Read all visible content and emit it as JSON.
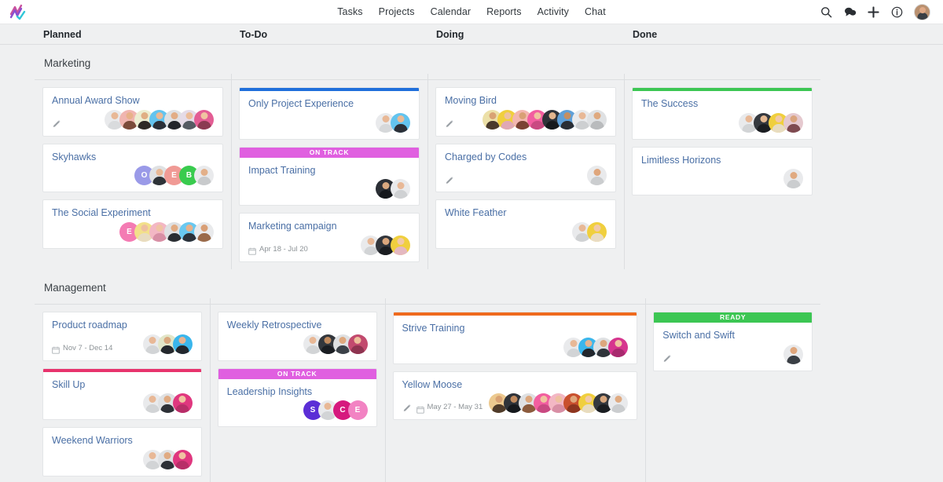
{
  "nav": {
    "logo_name": "zigzag-check-logo",
    "links": [
      {
        "label": "Tasks"
      },
      {
        "label": "Projects"
      },
      {
        "label": "Calendar"
      },
      {
        "label": "Reports"
      },
      {
        "label": "Activity"
      },
      {
        "label": "Chat"
      }
    ],
    "icons": [
      {
        "name": "search-icon"
      },
      {
        "name": "chat-bubble-icon"
      },
      {
        "name": "plus-icon"
      },
      {
        "name": "info-icon"
      }
    ]
  },
  "columns": [
    {
      "label": "Planned"
    },
    {
      "label": "To-Do"
    },
    {
      "label": "Doing"
    },
    {
      "label": "Done"
    }
  ],
  "colors": {
    "topbar_blue": "#1f6fdb",
    "topbar_green": "#3cc653",
    "topbar_orange": "#ef6a1d",
    "topbar_crimson": "#e8336d",
    "banner_ontrack": "#e05fe0",
    "banner_ready": "#3cc653",
    "card_title": "#4a6fa5",
    "page_bg": "#eff0f1"
  },
  "swimlanes": [
    {
      "title": "Marketing",
      "columns": [
        {
          "column": "Planned",
          "cards": [
            {
              "title": "Annual Award Show",
              "topbar": null,
              "banner": null,
              "date": null,
              "has_pencil": true,
              "avatars": [
                {
                  "type": "photo",
                  "bg": "#e9eaec",
                  "skin": "#e8b896",
                  "shirt": "#d9dbdd"
                },
                {
                  "type": "photo",
                  "bg": "#f0b5b0",
                  "skin": "#e8b189",
                  "shirt": "#7b4b3a"
                },
                {
                  "type": "photo",
                  "bg": "#eceed2",
                  "skin": "#e0ae84",
                  "shirt": "#2e2a26"
                },
                {
                  "type": "photo",
                  "bg": "#63c4ef",
                  "skin": "#e9b995",
                  "shirt": "#2b3038"
                },
                {
                  "type": "photo",
                  "bg": "#dfe1e3",
                  "skin": "#e2ad85",
                  "shirt": "#23262b"
                },
                {
                  "type": "photo",
                  "bg": "#e5dbe8",
                  "skin": "#ecbd9a",
                  "shirt": "#555b63"
                },
                {
                  "type": "photo",
                  "bg": "#e35d94",
                  "skin": "#f0c3a1",
                  "shirt": "#8b3a52"
                }
              ]
            },
            {
              "title": "Skyhawks",
              "topbar": null,
              "banner": null,
              "date": null,
              "has_pencil": false,
              "avatars": [
                {
                  "type": "letter",
                  "letter": "O",
                  "bg": "#9a9ae8"
                },
                {
                  "type": "photo",
                  "bg": "#dfe1e3",
                  "skin": "#e8b896",
                  "shirt": "#2e3338"
                },
                {
                  "type": "letter",
                  "letter": "E",
                  "bg": "#f09a95"
                },
                {
                  "type": "letter",
                  "letter": "B",
                  "bg": "#39cb4e"
                },
                {
                  "type": "photo",
                  "bg": "#e9eaec",
                  "skin": "#e3b089",
                  "shirt": "#c8cacc"
                }
              ]
            },
            {
              "title": "The Social Experiment",
              "topbar": null,
              "banner": null,
              "date": null,
              "has_pencil": false,
              "avatars": [
                {
                  "type": "letter",
                  "letter": "E",
                  "bg": "#f47bb3"
                },
                {
                  "type": "photo",
                  "bg": "#f2e08a",
                  "skin": "#eec0a0",
                  "shirt": "#e8dcc0"
                },
                {
                  "type": "photo",
                  "bg": "#f3b7c4",
                  "skin": "#f0c3a3",
                  "shirt": "#d88fa5"
                },
                {
                  "type": "photo",
                  "bg": "#dfe1e3",
                  "skin": "#e2ab82",
                  "shirt": "#2a2e33"
                },
                {
                  "type": "photo",
                  "bg": "#69c8f0",
                  "skin": "#e6b18c",
                  "shirt": "#2c3139"
                },
                {
                  "type": "photo",
                  "bg": "#e9eaec",
                  "skin": "#d99f76",
                  "shirt": "#9a6a4a"
                }
              ]
            }
          ]
        },
        {
          "column": "To-Do",
          "cards": [
            {
              "title": "Only Project Experience",
              "topbar": "#1f6fdb",
              "banner": null,
              "date": null,
              "has_pencil": false,
              "avatars": [
                {
                  "type": "photo",
                  "bg": "#e9eaec",
                  "skin": "#e8b896",
                  "shirt": "#d6d8da"
                },
                {
                  "type": "photo",
                  "bg": "#63c4ef",
                  "skin": "#eabb97",
                  "shirt": "#2b3038"
                }
              ]
            },
            {
              "title": "Impact Training",
              "topbar": null,
              "banner": "ON TRACK",
              "banner_color": "#e05fe0",
              "date": null,
              "has_pencil": false,
              "avatars": [
                {
                  "type": "photo",
                  "bg": "#2b2f35",
                  "skin": "#d9a87f",
                  "shirt": "#15181c"
                },
                {
                  "type": "photo",
                  "bg": "#e9eaec",
                  "skin": "#e8b896",
                  "shirt": "#cfd1d3"
                }
              ]
            },
            {
              "title": "Marketing campaign",
              "topbar": null,
              "banner": null,
              "date": "Apr 18 - Jul 20",
              "has_pencil": false,
              "avatars": [
                {
                  "type": "photo",
                  "bg": "#e9eaec",
                  "skin": "#e8b896",
                  "shirt": "#d2d4d6"
                },
                {
                  "type": "photo",
                  "bg": "#32363c",
                  "skin": "#dba77d",
                  "shirt": "#1a1d21"
                },
                {
                  "type": "photo",
                  "bg": "#f0cf3e",
                  "skin": "#f2c9a8",
                  "shirt": "#e4b8c0"
                }
              ]
            }
          ]
        },
        {
          "column": "Doing",
          "cards": [
            {
              "title": "Moving Bird",
              "topbar": null,
              "banner": null,
              "date": null,
              "has_pencil": true,
              "avatars": [
                {
                  "type": "photo",
                  "bg": "#ece0a8",
                  "skin": "#d9a274",
                  "shirt": "#4a3a2c"
                },
                {
                  "type": "photo",
                  "bg": "#f0cf3e",
                  "skin": "#eec2a0",
                  "shirt": "#e0a8b4"
                },
                {
                  "type": "photo",
                  "bg": "#f3b7b0",
                  "skin": "#d9a075",
                  "shirt": "#7a4233"
                },
                {
                  "type": "photo",
                  "bg": "#f25ea0",
                  "skin": "#f0c3a1",
                  "shirt": "#c94a82"
                },
                {
                  "type": "photo",
                  "bg": "#2f3339",
                  "skin": "#e3b68e",
                  "shirt": "#16191d"
                },
                {
                  "type": "photo",
                  "bg": "#5fa0d8",
                  "skin": "#c58f62",
                  "shirt": "#2a2e35"
                },
                {
                  "type": "photo",
                  "bg": "#e9eaec",
                  "skin": "#e8b896",
                  "shirt": "#cdcfd1"
                },
                {
                  "type": "photo",
                  "bg": "#dfe1e3",
                  "skin": "#dfa97f",
                  "shirt": "#b9bbbd"
                }
              ]
            },
            {
              "title": "Charged by Codes",
              "topbar": null,
              "banner": null,
              "date": null,
              "has_pencil": true,
              "avatars": [
                {
                  "type": "photo",
                  "bg": "#e9eaec",
                  "skin": "#dfa67c",
                  "shirt": "#cbcdcf"
                }
              ]
            },
            {
              "title": "White Feather",
              "topbar": null,
              "banner": null,
              "date": null,
              "has_pencil": false,
              "avatars": [
                {
                  "type": "photo",
                  "bg": "#e9eaec",
                  "skin": "#e8b896",
                  "shirt": "#d0d2d4"
                },
                {
                  "type": "photo",
                  "bg": "#f0cf3e",
                  "skin": "#f2c9a8",
                  "shirt": "#e9dcc4"
                }
              ]
            }
          ]
        },
        {
          "column": "Done",
          "cards": [
            {
              "title": "The Success",
              "topbar": "#3cc653",
              "banner": null,
              "date": null,
              "has_pencil": false,
              "avatars": [
                {
                  "type": "photo",
                  "bg": "#e9eaec",
                  "skin": "#e8b896",
                  "shirt": "#d2d4d6"
                },
                {
                  "type": "photo",
                  "bg": "#35393f",
                  "skin": "#e5b992",
                  "shirt": "#1b1e22"
                },
                {
                  "type": "photo",
                  "bg": "#f0cf3e",
                  "skin": "#f2c9a8",
                  "shirt": "#e8dcc0"
                },
                {
                  "type": "photo",
                  "bg": "#e5c9cf",
                  "skin": "#daa47e",
                  "shirt": "#7e4a50"
                }
              ]
            },
            {
              "title": "Limitless Horizons",
              "topbar": null,
              "banner": null,
              "date": null,
              "has_pencil": false,
              "avatars": [
                {
                  "type": "photo",
                  "bg": "#e9eaec",
                  "skin": "#e0aa81",
                  "shirt": "#cbcdcf"
                }
              ]
            }
          ]
        }
      ]
    },
    {
      "title": "Management",
      "columns": [
        {
          "column": "Planned",
          "cards": [
            {
              "title": "Product roadmap",
              "topbar": null,
              "banner": null,
              "date": "Nov 7 - Dec 14",
              "has_pencil": false,
              "avatars": [
                {
                  "type": "photo",
                  "bg": "#e9eaec",
                  "skin": "#e8b896",
                  "shirt": "#d2d4d6"
                },
                {
                  "type": "photo",
                  "bg": "#e2e6c8",
                  "skin": "#d9a87f",
                  "shirt": "#24282d"
                },
                {
                  "type": "photo",
                  "bg": "#3ab6ec",
                  "skin": "#e6b493",
                  "shirt": "#23272d"
                }
              ]
            },
            {
              "title": "Skill Up",
              "topbar": "#e8336d",
              "banner": null,
              "date": null,
              "has_pencil": false,
              "avatars": [
                {
                  "type": "photo",
                  "bg": "#e9eaec",
                  "skin": "#e8b896",
                  "shirt": "#d2d4d6"
                },
                {
                  "type": "photo",
                  "bg": "#dfe1e3",
                  "skin": "#e0ab83",
                  "shirt": "#2d3137"
                },
                {
                  "type": "photo",
                  "bg": "#e0377f",
                  "skin": "#f0c3a1",
                  "shirt": "#b82e68"
                }
              ]
            },
            {
              "title": "Weekend Warriors",
              "topbar": null,
              "banner": null,
              "date": null,
              "has_pencil": false,
              "avatars": [
                {
                  "type": "photo",
                  "bg": "#e9eaec",
                  "skin": "#e8b896",
                  "shirt": "#d2d4d6"
                },
                {
                  "type": "photo",
                  "bg": "#dfe1e3",
                  "skin": "#e0ab83",
                  "shirt": "#2d3137"
                },
                {
                  "type": "photo",
                  "bg": "#e0377f",
                  "skin": "#f0c3a1",
                  "shirt": "#b82e68"
                }
              ]
            }
          ]
        },
        {
          "column": "To-Do",
          "cards": [
            {
              "title": "Weekly Retrospective",
              "topbar": null,
              "banner": null,
              "date": null,
              "has_pencil": false,
              "avatars": [
                {
                  "type": "photo",
                  "bg": "#e9eaec",
                  "skin": "#e8b896",
                  "shirt": "#d2d4d6"
                },
                {
                  "type": "photo",
                  "bg": "#33373d",
                  "skin": "#c08a5e",
                  "shirt": "#1a1d22"
                },
                {
                  "type": "photo",
                  "bg": "#dfe1e3",
                  "skin": "#dfa87e",
                  "shirt": "#3b4148"
                },
                {
                  "type": "photo",
                  "bg": "#c24a6e",
                  "skin": "#edbf9c",
                  "shirt": "#8e3450"
                }
              ]
            },
            {
              "title": "Leadership Insights",
              "topbar": null,
              "banner": "ON TRACK",
              "banner_color": "#e05fe0",
              "date": null,
              "has_pencil": false,
              "avatars": [
                {
                  "type": "letter",
                  "letter": "S",
                  "bg": "#5b2ed6"
                },
                {
                  "type": "photo",
                  "bg": "#e9eaec",
                  "skin": "#e8b896",
                  "shirt": "#d2d4d6"
                },
                {
                  "type": "letter",
                  "letter": "C",
                  "bg": "#d6197e"
                },
                {
                  "type": "letter",
                  "letter": "E",
                  "bg": "#f283c3"
                }
              ]
            }
          ]
        },
        {
          "column": "Doing",
          "cards": [
            {
              "title": "Strive Training",
              "topbar": "#ef6a1d",
              "banner": null,
              "date": null,
              "has_pencil": false,
              "avatars": [
                {
                  "type": "photo",
                  "bg": "#e9eaec",
                  "skin": "#e8b896",
                  "shirt": "#d2d4d6"
                },
                {
                  "type": "photo",
                  "bg": "#3ab6ec",
                  "skin": "#e4b391",
                  "shirt": "#22262c"
                },
                {
                  "type": "photo",
                  "bg": "#dfe1e3",
                  "skin": "#dda77d",
                  "shirt": "#2f343a"
                },
                {
                  "type": "photo",
                  "bg": "#d6358e",
                  "skin": "#f0c3a1",
                  "shirt": "#a82a6e"
                }
              ]
            },
            {
              "title": "Yellow Moose",
              "topbar": null,
              "banner": null,
              "date": "May 27 - May 31",
              "has_pencil": true,
              "avatars": [
                {
                  "type": "photo",
                  "bg": "#ecc98f",
                  "skin": "#d9a274",
                  "shirt": "#4f3b2a"
                },
                {
                  "type": "photo",
                  "bg": "#2f3339",
                  "skin": "#c08a5e",
                  "shirt": "#16191d"
                },
                {
                  "type": "photo",
                  "bg": "#dfe1e3",
                  "skin": "#dda77d",
                  "shirt": "#8c5b3d"
                },
                {
                  "type": "photo",
                  "bg": "#f25ea0",
                  "skin": "#f0c3a1",
                  "shirt": "#c94a82"
                },
                {
                  "type": "photo",
                  "bg": "#f3b7c4",
                  "skin": "#eec0a0",
                  "shirt": "#d88fa5"
                },
                {
                  "type": "photo",
                  "bg": "#c9502e",
                  "skin": "#e0a77c",
                  "shirt": "#8e3620"
                },
                {
                  "type": "photo",
                  "bg": "#f0cf3e",
                  "skin": "#f2c9a8",
                  "shirt": "#e8dcc0"
                },
                {
                  "type": "photo",
                  "bg": "#35393f",
                  "skin": "#d9a87f",
                  "shirt": "#1b1e22"
                },
                {
                  "type": "photo",
                  "bg": "#e9eaec",
                  "skin": "#e0aa81",
                  "shirt": "#cbcdcf"
                }
              ]
            }
          ]
        },
        {
          "column": "Done",
          "cards": [
            {
              "title": "Switch and Swift",
              "topbar": null,
              "banner": "READY",
              "banner_color": "#3cc653",
              "date": null,
              "has_pencil": true,
              "avatars": [
                {
                  "type": "photo",
                  "bg": "#e9eaec",
                  "skin": "#dfa67c",
                  "shirt": "#3a3f45"
                }
              ]
            }
          ]
        }
      ]
    }
  ]
}
